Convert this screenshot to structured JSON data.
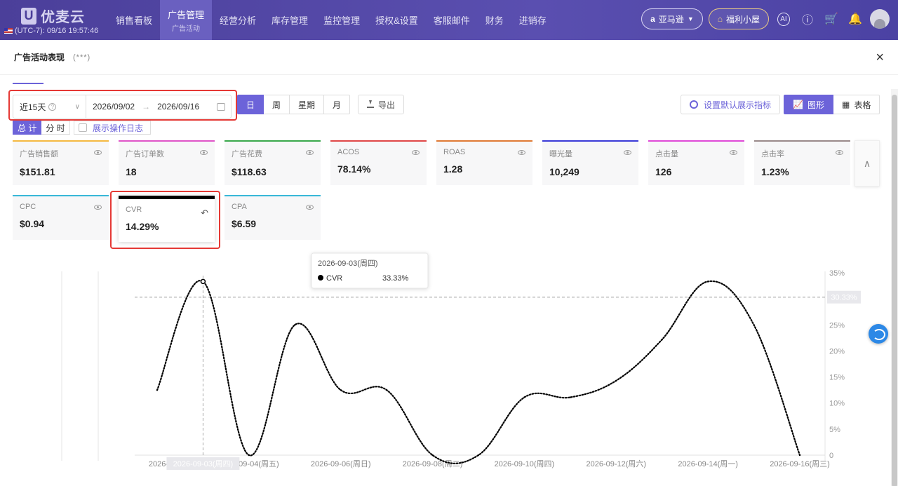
{
  "app": {
    "logo_mark": "U",
    "logo_text": "优麦云",
    "timezone": "(UTC-7): 09/16 19:57:46"
  },
  "menu": [
    {
      "label": "销售看板"
    },
    {
      "label": "广告管理",
      "sub": "广告活动",
      "active": true
    },
    {
      "label": "经营分析"
    },
    {
      "label": "库存管理"
    },
    {
      "label": "监控管理"
    },
    {
      "label": "授权&设置"
    },
    {
      "label": "客服邮件"
    },
    {
      "label": "财务"
    },
    {
      "label": "进销存"
    }
  ],
  "nav_right": {
    "marketplace": "亚马逊",
    "marketplace_icon": "a",
    "welfare": "福利小屋",
    "ai_label": "AI"
  },
  "modal": {
    "title": "广告活动表现",
    "subtitle": "(***)",
    "close": "×"
  },
  "toolbar": {
    "preset": "近15天",
    "date_start": "2026/09/02",
    "date_end": "2026/09/16",
    "granularity": [
      "日",
      "周",
      "星期",
      "月"
    ],
    "export": "导出",
    "default_metrics": "设置默认展示指标",
    "view_chart": "图形",
    "view_table": "表格",
    "total": "总 计",
    "split": "分 时",
    "show_log": "展示操作日志"
  },
  "metrics": [
    {
      "label": "广告销售额",
      "value": "$151.81",
      "color": "#f5b942"
    },
    {
      "label": "广告订单数",
      "value": "18",
      "color": "#e055c8"
    },
    {
      "label": "广告花费",
      "value": "$118.63",
      "color": "#3aa84c"
    },
    {
      "label": "ACOS",
      "value": "78.14%",
      "color": "#e04848"
    },
    {
      "label": "ROAS",
      "value": "1.28",
      "color": "#e07a35"
    },
    {
      "label": "曝光量",
      "value": "10,249",
      "color": "#3b3bd8"
    },
    {
      "label": "点击量",
      "value": "126",
      "color": "#e04ad8"
    },
    {
      "label": "点击率",
      "value": "1.23%",
      "color": "#9a8a8a"
    },
    {
      "label": "CPC",
      "value": "$0.94",
      "color": "#38b8d8"
    },
    {
      "label": "CVR",
      "value": "14.29%",
      "color": "#000000",
      "selected": true
    },
    {
      "label": "CPA",
      "value": "$6.59",
      "color": "#38b8d8"
    }
  ],
  "chart_data": {
    "type": "line",
    "series": [
      {
        "name": "CVR",
        "values": [
          12.5,
          33.33,
          0,
          25,
          12.5,
          12.5,
          0,
          0,
          11.1,
          11.1,
          14.3,
          22.2,
          33.33,
          25,
          0
        ]
      }
    ],
    "x": [
      "2026-09-02",
      "2026-09-03",
      "2026-09-04",
      "2026-09-05",
      "2026-09-06",
      "2026-09-07",
      "2026-09-08",
      "2026-09-09",
      "2026-09-10",
      "2026-09-11",
      "2026-09-12",
      "2026-09-13",
      "2026-09-14",
      "2026-09-15",
      "2026-09-16"
    ],
    "x_tick_labels": [
      "2026-09-02",
      "2026-09-04(周五)",
      "2026-09-06(周日)",
      "2026-09-08(周二)",
      "2026-09-10(周四)",
      "2026-09-12(周六)",
      "2026-09-14(周一)",
      "2026-09-16(周三)"
    ],
    "x_tick_index": [
      0,
      2,
      4,
      6,
      8,
      10,
      12,
      14
    ],
    "y_tick_labels": [
      "0",
      "5%",
      "10%",
      "15%",
      "20%",
      "25%",
      "30%",
      "35%"
    ],
    "ylim": [
      0,
      35
    ],
    "hover_index": 1,
    "hover_x_label": "2026-09-03(周四)",
    "crosshair_value": 30.33,
    "crosshair_label": "30.33%",
    "tooltip": {
      "title": "2026-09-03(周四)",
      "series": "CVR",
      "value": "33.33%"
    },
    "line_color": "#000000"
  }
}
